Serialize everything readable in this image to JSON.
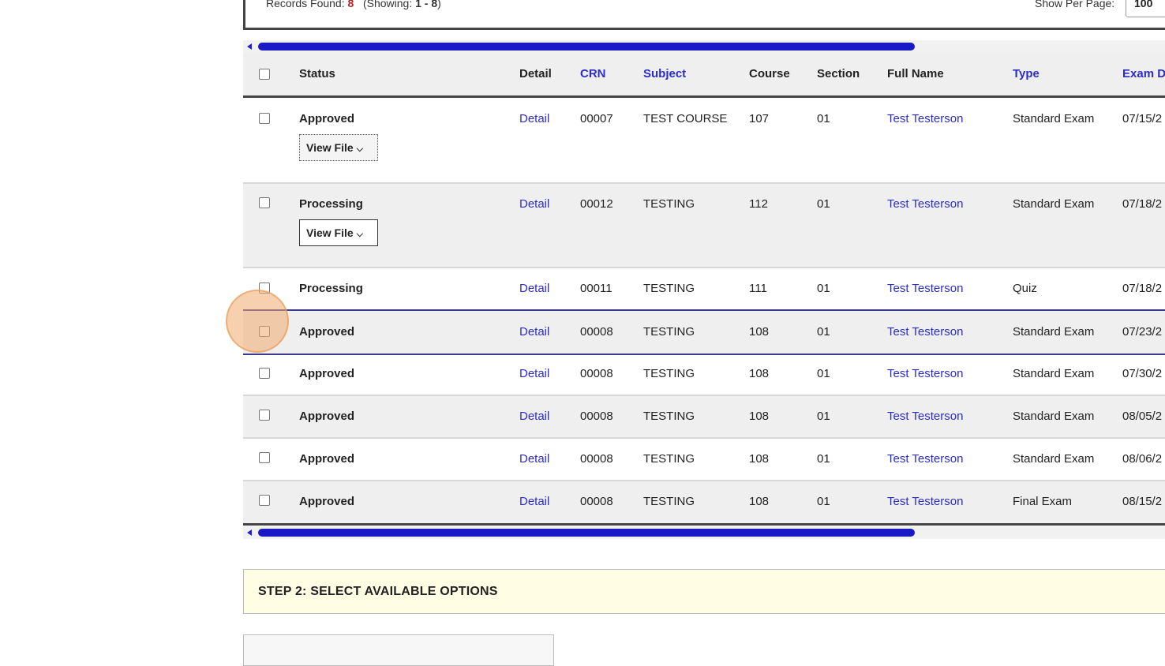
{
  "records": {
    "label": "Records Found:",
    "count": "8",
    "showing_label": "(Showing:",
    "showing_range_start": "1",
    "showing_dash": " - ",
    "showing_range_end": "8",
    "showing_close": ")"
  },
  "per_page": {
    "label": "Show Per Page:",
    "value": "100"
  },
  "columns": {
    "status": "Status",
    "detail": "Detail",
    "crn": "CRN",
    "subject": "Subject",
    "course": "Course",
    "section": "Section",
    "full_name": "Full Name",
    "type": "Type",
    "exam_date": "Exam Da"
  },
  "rows": [
    {
      "status": "Approved",
      "detail": "Detail",
      "crn": "00007",
      "subject": "TEST COURSE",
      "course": "107",
      "section": "01",
      "full_name": "Test Testerson",
      "type": "Standard Exam",
      "exam_date": "07/15/2",
      "view_file": "View File"
    },
    {
      "status": "Processing",
      "detail": "Detail",
      "crn": "00012",
      "subject": "TESTING",
      "course": "112",
      "section": "01",
      "full_name": "Test Testerson",
      "type": "Standard Exam",
      "exam_date": "07/18/2",
      "view_file": "View File"
    },
    {
      "status": "Processing",
      "detail": "Detail",
      "crn": "00011",
      "subject": "TESTING",
      "course": "111",
      "section": "01",
      "full_name": "Test Testerson",
      "type": "Quiz",
      "exam_date": "07/18/2"
    },
    {
      "status": "Approved",
      "detail": "Detail",
      "crn": "00008",
      "subject": "TESTING",
      "course": "108",
      "section": "01",
      "full_name": "Test Testerson",
      "type": "Standard Exam",
      "exam_date": "07/23/2"
    },
    {
      "status": "Approved",
      "detail": "Detail",
      "crn": "00008",
      "subject": "TESTING",
      "course": "108",
      "section": "01",
      "full_name": "Test Testerson",
      "type": "Standard Exam",
      "exam_date": "07/30/2"
    },
    {
      "status": "Approved",
      "detail": "Detail",
      "crn": "00008",
      "subject": "TESTING",
      "course": "108",
      "section": "01",
      "full_name": "Test Testerson",
      "type": "Standard Exam",
      "exam_date": "08/05/2"
    },
    {
      "status": "Approved",
      "detail": "Detail",
      "crn": "00008",
      "subject": "TESTING",
      "course": "108",
      "section": "01",
      "full_name": "Test Testerson",
      "type": "Standard Exam",
      "exam_date": "08/06/2"
    },
    {
      "status": "Approved",
      "detail": "Detail",
      "crn": "00008",
      "subject": "TESTING",
      "course": "108",
      "section": "01",
      "full_name": "Test Testerson",
      "type": "Final Exam",
      "exam_date": "08/15/2"
    }
  ],
  "step2": {
    "title": "STEP 2: SELECT AVAILABLE OPTIONS"
  },
  "icons": {
    "chevron": "chevron-down-icon",
    "scroll_left": "scroll-left-arrow-icon"
  },
  "colors": {
    "link": "#2c2cc8",
    "scroll_thumb": "#1919c8",
    "step_bg": "#fffde4",
    "cursor_highlight": "#f0aa6e"
  }
}
